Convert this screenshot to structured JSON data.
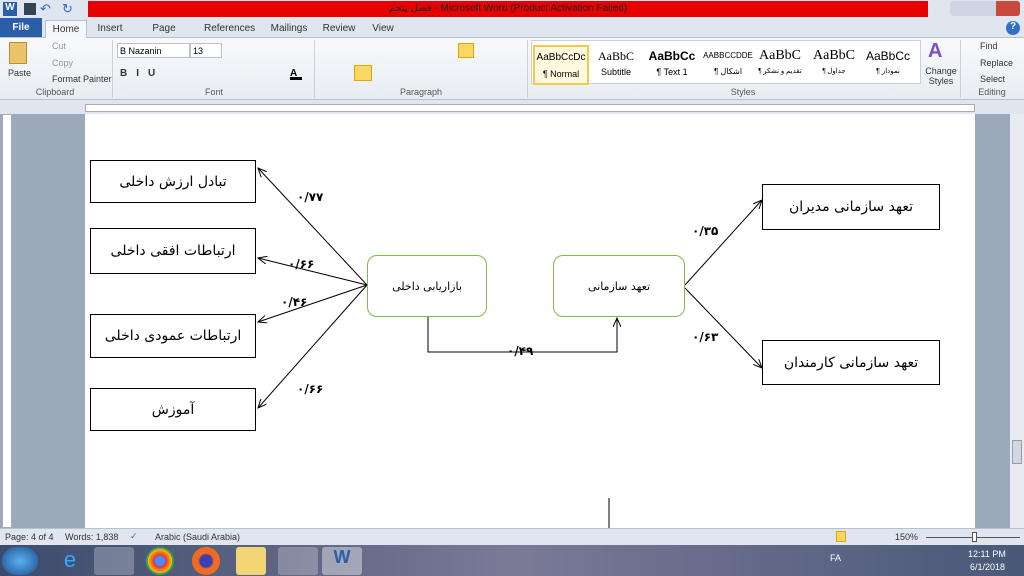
{
  "window": {
    "title": "فصل پنجم - Microsoft Word (Product Activation Failed)"
  },
  "tabs": [
    "File",
    "Home",
    "Insert",
    "Page Layout",
    "References",
    "Mailings",
    "Review",
    "View"
  ],
  "clipboard": {
    "paste": "Paste",
    "cut": "Cut",
    "copy": "Copy",
    "format_painter": "Format Painter",
    "group": "Clipboard"
  },
  "font": {
    "name": "B Nazanin",
    "size": "13",
    "group": "Font"
  },
  "paragraph": {
    "group": "Paragraph"
  },
  "styles": {
    "group": "Styles",
    "items": [
      {
        "sample": "AaBbCcDc",
        "label": "¶ Normal"
      },
      {
        "sample": "AaBbC",
        "label": "Subtitle"
      },
      {
        "sample": "AaBbCc",
        "label": "¶ Text 1"
      },
      {
        "sample": "AABBCCDDE",
        "label": "¶ اشکال"
      },
      {
        "sample": "AaBbC",
        "label": "¶ تقدیم و تشکر"
      },
      {
        "sample": "AaBbC",
        "label": "¶ جداول"
      },
      {
        "sample": "AaBbCc",
        "label": "¶ نمودار"
      }
    ],
    "change": "Change Styles"
  },
  "editing": {
    "group": "Editing",
    "find": "Find",
    "replace": "Replace",
    "select": "Select"
  },
  "diagram": {
    "left_boxes": [
      "تبادل ارزش داخلی",
      "ارتباطات افقی داخلی",
      "ارتباطات عمودی داخلی",
      "آموزش"
    ],
    "left_weights": [
      "۰/۷۷",
      "۰/۶۶",
      "۰/۴۶",
      "۰/۶۶"
    ],
    "center": "بازاریابی داخلی",
    "center_right": "تعهد سازمانی",
    "center_weight": "۰/۴۹",
    "right_boxes": [
      "تعهد سازمانی مدیران",
      "تعهد سازمانی کارمندان"
    ],
    "right_weights": [
      "۰/۳۵",
      "۰/۶۳"
    ]
  },
  "status": {
    "page": "Page: 4 of 4",
    "words": "Words: 1,838",
    "language": "Arabic (Saudi Arabia)",
    "zoom": "150%"
  },
  "tray": {
    "lang": "FA",
    "time": "12:11 PM",
    "date": "6/1/2018"
  }
}
